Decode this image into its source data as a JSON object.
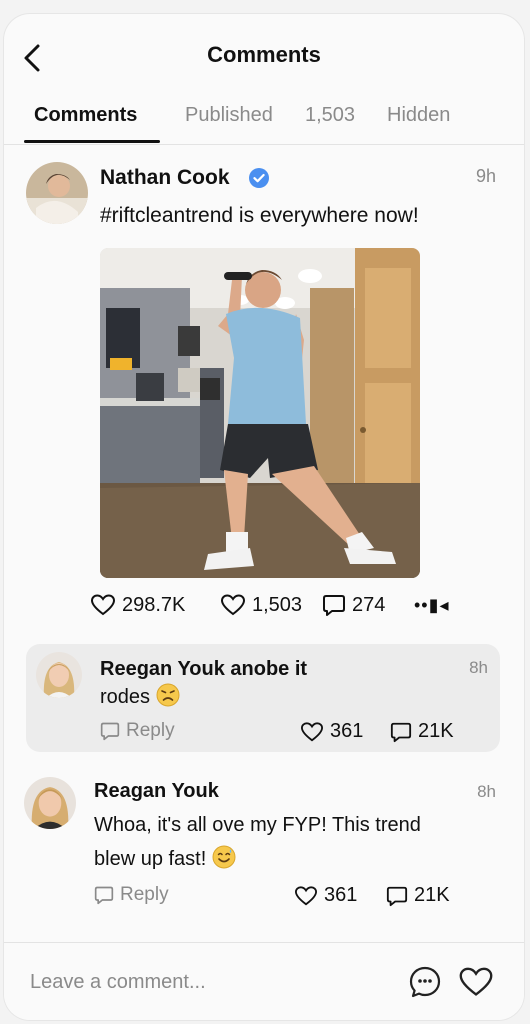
{
  "header": {
    "title": "Comments",
    "back_icon": "chevron-left-icon"
  },
  "tabs": [
    {
      "label": "Comments",
      "active": true
    },
    {
      "label": "Published",
      "active": false
    },
    {
      "label": "1,503",
      "active": false
    },
    {
      "label": "Hidden",
      "active": false
    }
  ],
  "post": {
    "author": "Nathan Cook",
    "verified": true,
    "time": "9h",
    "text": "#riftcleantrend is everywhere now!",
    "likes": "298.7K",
    "shares": "1,503",
    "comments": "274",
    "more": "••▮◂"
  },
  "comments": [
    {
      "author": "Reegan Youk anobe it",
      "text": "rodes",
      "emoji": "disappointed-face",
      "time": "8h",
      "reply_label": "Reply",
      "likes": "361",
      "replies": "21K",
      "highlighted": true
    },
    {
      "author": "Reagan Youk",
      "text_line1": "Whoa, it's all ove my FYP! This trend",
      "text_line2": "blew up fast!",
      "emoji": "sweat-smile-face",
      "time": "8h",
      "reply_label": "Reply",
      "likes": "361",
      "replies": "21K",
      "highlighted": false
    }
  ],
  "composer": {
    "placeholder": "Leave a comment...",
    "emoji_icon": "emoji-icon",
    "heart_icon": "heart-icon"
  },
  "colors": {
    "verified": "#4a8ff0",
    "muted": "#8a8a8a",
    "card_bg": "#ececec"
  }
}
